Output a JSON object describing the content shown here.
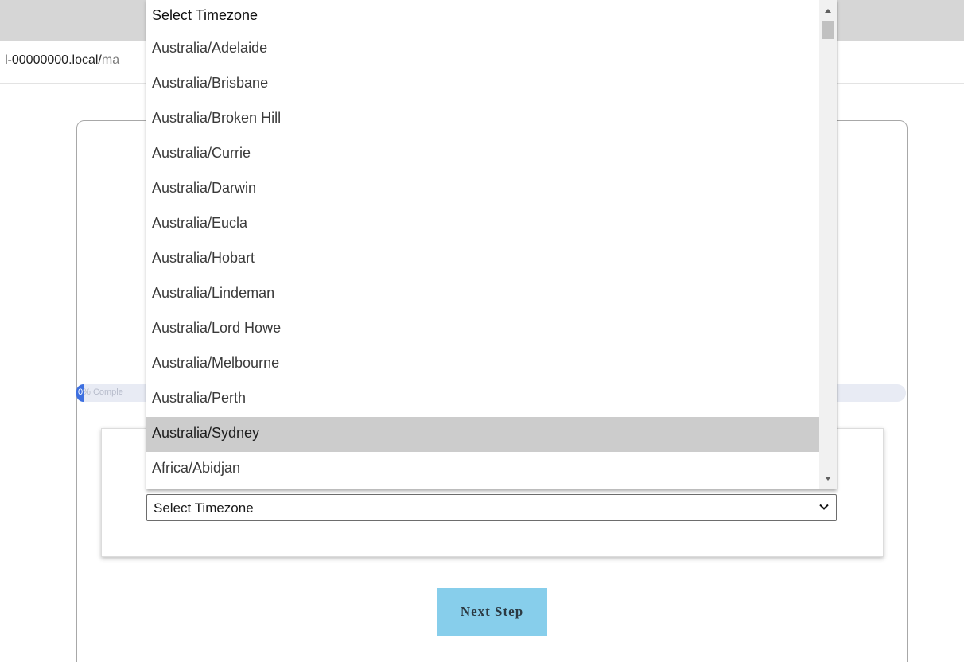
{
  "browser": {
    "url_host": "l-00000000.local/",
    "url_path": "ma"
  },
  "progress": {
    "percent_value": 0,
    "label_number": "0",
    "label_text": "% Comple"
  },
  "timezone_select": {
    "selected_value": "Select Timezone",
    "options": [
      "Select Timezone",
      "Australia/Adelaide",
      "Australia/Brisbane",
      "Australia/Broken Hill",
      "Australia/Currie",
      "Australia/Darwin",
      "Australia/Eucla",
      "Australia/Hobart",
      "Australia/Lindeman",
      "Australia/Lord Howe",
      "Australia/Melbourne",
      "Australia/Perth",
      "Australia/Sydney",
      "Africa/Abidjan"
    ],
    "highlighted_option": "Australia/Sydney"
  },
  "actions": {
    "next_step_label": "Next Step"
  },
  "colors": {
    "button_bg": "#87ceeb",
    "progress_fill": "#3d6fe0",
    "progress_track": "#e8ebf4",
    "highlight": "#cccccc"
  },
  "icons": {
    "select_chevron": "chevron-down-icon",
    "scroll_up": "triangle-up-icon",
    "scroll_down": "triangle-down-icon"
  }
}
